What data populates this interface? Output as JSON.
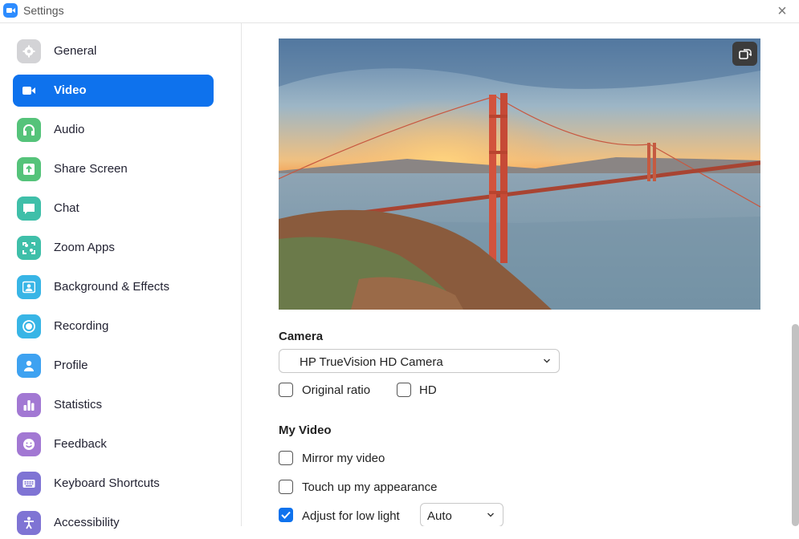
{
  "window": {
    "title": "Settings",
    "close_icon": "×"
  },
  "sidebar": {
    "items": [
      {
        "label": "General",
        "icon": "gear-icon",
        "color": "#d3d3d6",
        "active": false
      },
      {
        "label": "Video",
        "icon": "video-camera-icon",
        "color": "#0e72ed",
        "active": true
      },
      {
        "label": "Audio",
        "icon": "headphones-icon",
        "color": "#55c37a",
        "active": false
      },
      {
        "label": "Share Screen",
        "icon": "share-screen-icon",
        "color": "#55c37a",
        "active": false
      },
      {
        "label": "Chat",
        "icon": "chat-bubble-icon",
        "color": "#3fbfa9",
        "active": false
      },
      {
        "label": "Zoom Apps",
        "icon": "apps-icon",
        "color": "#3fbfa9",
        "active": false
      },
      {
        "label": "Background & Effects",
        "icon": "person-background-icon",
        "color": "#38b5e6",
        "active": false
      },
      {
        "label": "Recording",
        "icon": "record-icon",
        "color": "#38b5e6",
        "active": false
      },
      {
        "label": "Profile",
        "icon": "person-icon",
        "color": "#3ea2f1",
        "active": false
      },
      {
        "label": "Statistics",
        "icon": "bar-chart-icon",
        "color": "#a278d3",
        "active": false
      },
      {
        "label": "Feedback",
        "icon": "smiley-icon",
        "color": "#a278d3",
        "active": false
      },
      {
        "label": "Keyboard Shortcuts",
        "icon": "keyboard-icon",
        "color": "#7f74d4",
        "active": false
      },
      {
        "label": "Accessibility",
        "icon": "accessibility-icon",
        "color": "#7f74d4",
        "active": false
      }
    ]
  },
  "camera": {
    "title": "Camera",
    "selected": "HP TrueVision HD Camera",
    "original_ratio_label": "Original ratio",
    "original_ratio_checked": false,
    "hd_label": "HD",
    "hd_checked": false
  },
  "my_video": {
    "title": "My Video",
    "mirror_label": "Mirror my video",
    "mirror_checked": false,
    "touch_up_label": "Touch up my appearance",
    "touch_up_checked": false,
    "low_light_label": "Adjust for low light",
    "low_light_checked": true,
    "low_light_mode": "Auto"
  },
  "colors": {
    "accent": "#0e72ed"
  }
}
